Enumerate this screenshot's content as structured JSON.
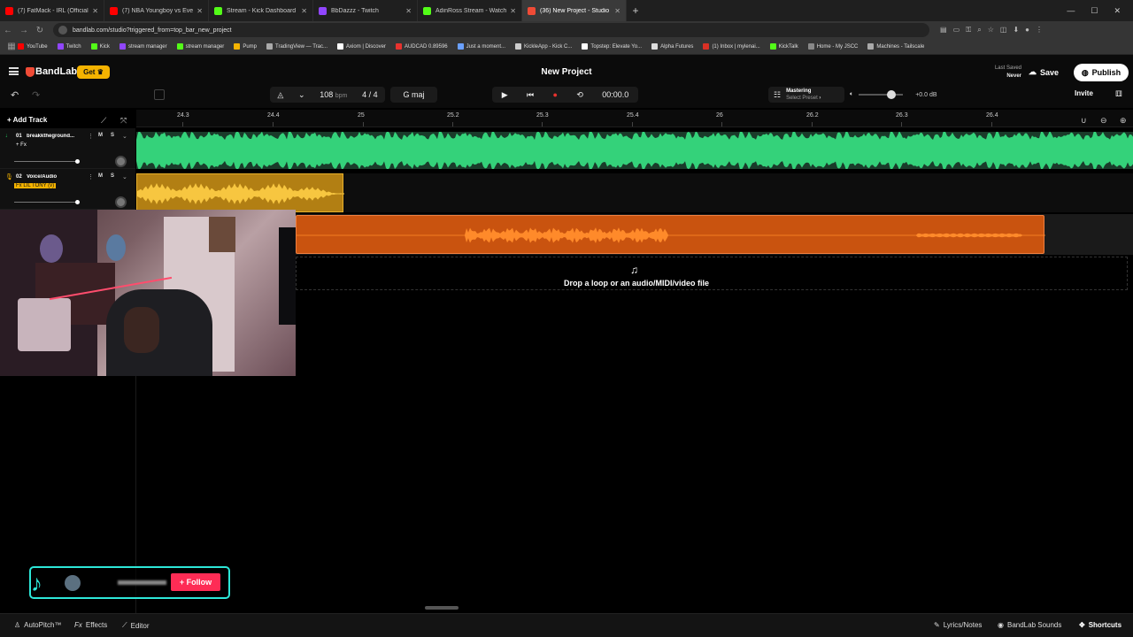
{
  "browser": {
    "tabs": [
      {
        "title": "(7) FatMack - IRL (Official Mus...",
        "color": "#ff0000"
      },
      {
        "title": "(7) NBA Youngboy vs Everybod...",
        "color": "#ff0000"
      },
      {
        "title": "Stream - Kick Dashboard",
        "color": "#53fc18"
      },
      {
        "title": "BbDazzz - Twitch",
        "color": "#9146ff"
      },
      {
        "title": "AdinRoss Stream - Watch Live ...",
        "color": "#53fc18"
      },
      {
        "title": "(36) New Project - Studio",
        "color": "#f04b36",
        "active": true
      }
    ],
    "url": "bandlab.com/studio?triggered_from=top_bar_new_project",
    "bookmarks": [
      "YouTube",
      "Twitch",
      "Kick",
      "stream manager",
      "stream manager",
      "Pump",
      "TradingView — Trac...",
      "Axiom | Discover",
      "AUDCAD 0.89596",
      "Just a moment...",
      "KickleApp - Kick C...",
      "Topstep: Elevate Yo...",
      "Alpha Futures",
      "(1) Inbox | mylenai...",
      "KickTalk",
      "Home - My JSCC",
      "Machines - Tailscale"
    ]
  },
  "app": {
    "logo": "BandLab",
    "get_label": "Get",
    "project_title": "New Project",
    "last_saved_label": "Last Saved",
    "last_saved_value": "Never",
    "save_label": "Save",
    "publish_label": "Publish",
    "invite_label": "Invite",
    "tempo": "108",
    "tempo_unit": "bpm",
    "time_sig_num": "4",
    "time_sig_den": "4",
    "key": "G maj",
    "time": "00:00.0",
    "mastering_title": "Mastering",
    "mastering_sub": "Select Preset",
    "volume_db": "+0.0 dB",
    "add_track_label": "Add Track",
    "drop_text": "Drop a loop or an audio/MIDI/video file"
  },
  "ruler": [
    "24.3",
    "24.4",
    "25",
    "25.2",
    "25.3",
    "25.4",
    "26",
    "26.2",
    "26.3",
    "26.4"
  ],
  "tracks": [
    {
      "num": "01",
      "name": "breakktheground...",
      "fx": "+ Fx",
      "color": "#22c55e"
    },
    {
      "num": "02",
      "name": "Voice/Audio",
      "fx": "Fx LIL TONY (v)",
      "color": "#f5b300"
    }
  ],
  "tiktok": {
    "follow_label": "+ Follow"
  },
  "bottom": {
    "autopitch": "AutoPitch™",
    "effects": "Effects",
    "editor": "Editor",
    "lyrics": "Lyrics/Notes",
    "sounds": "BandLab Sounds",
    "shortcuts": "Shortcuts"
  }
}
